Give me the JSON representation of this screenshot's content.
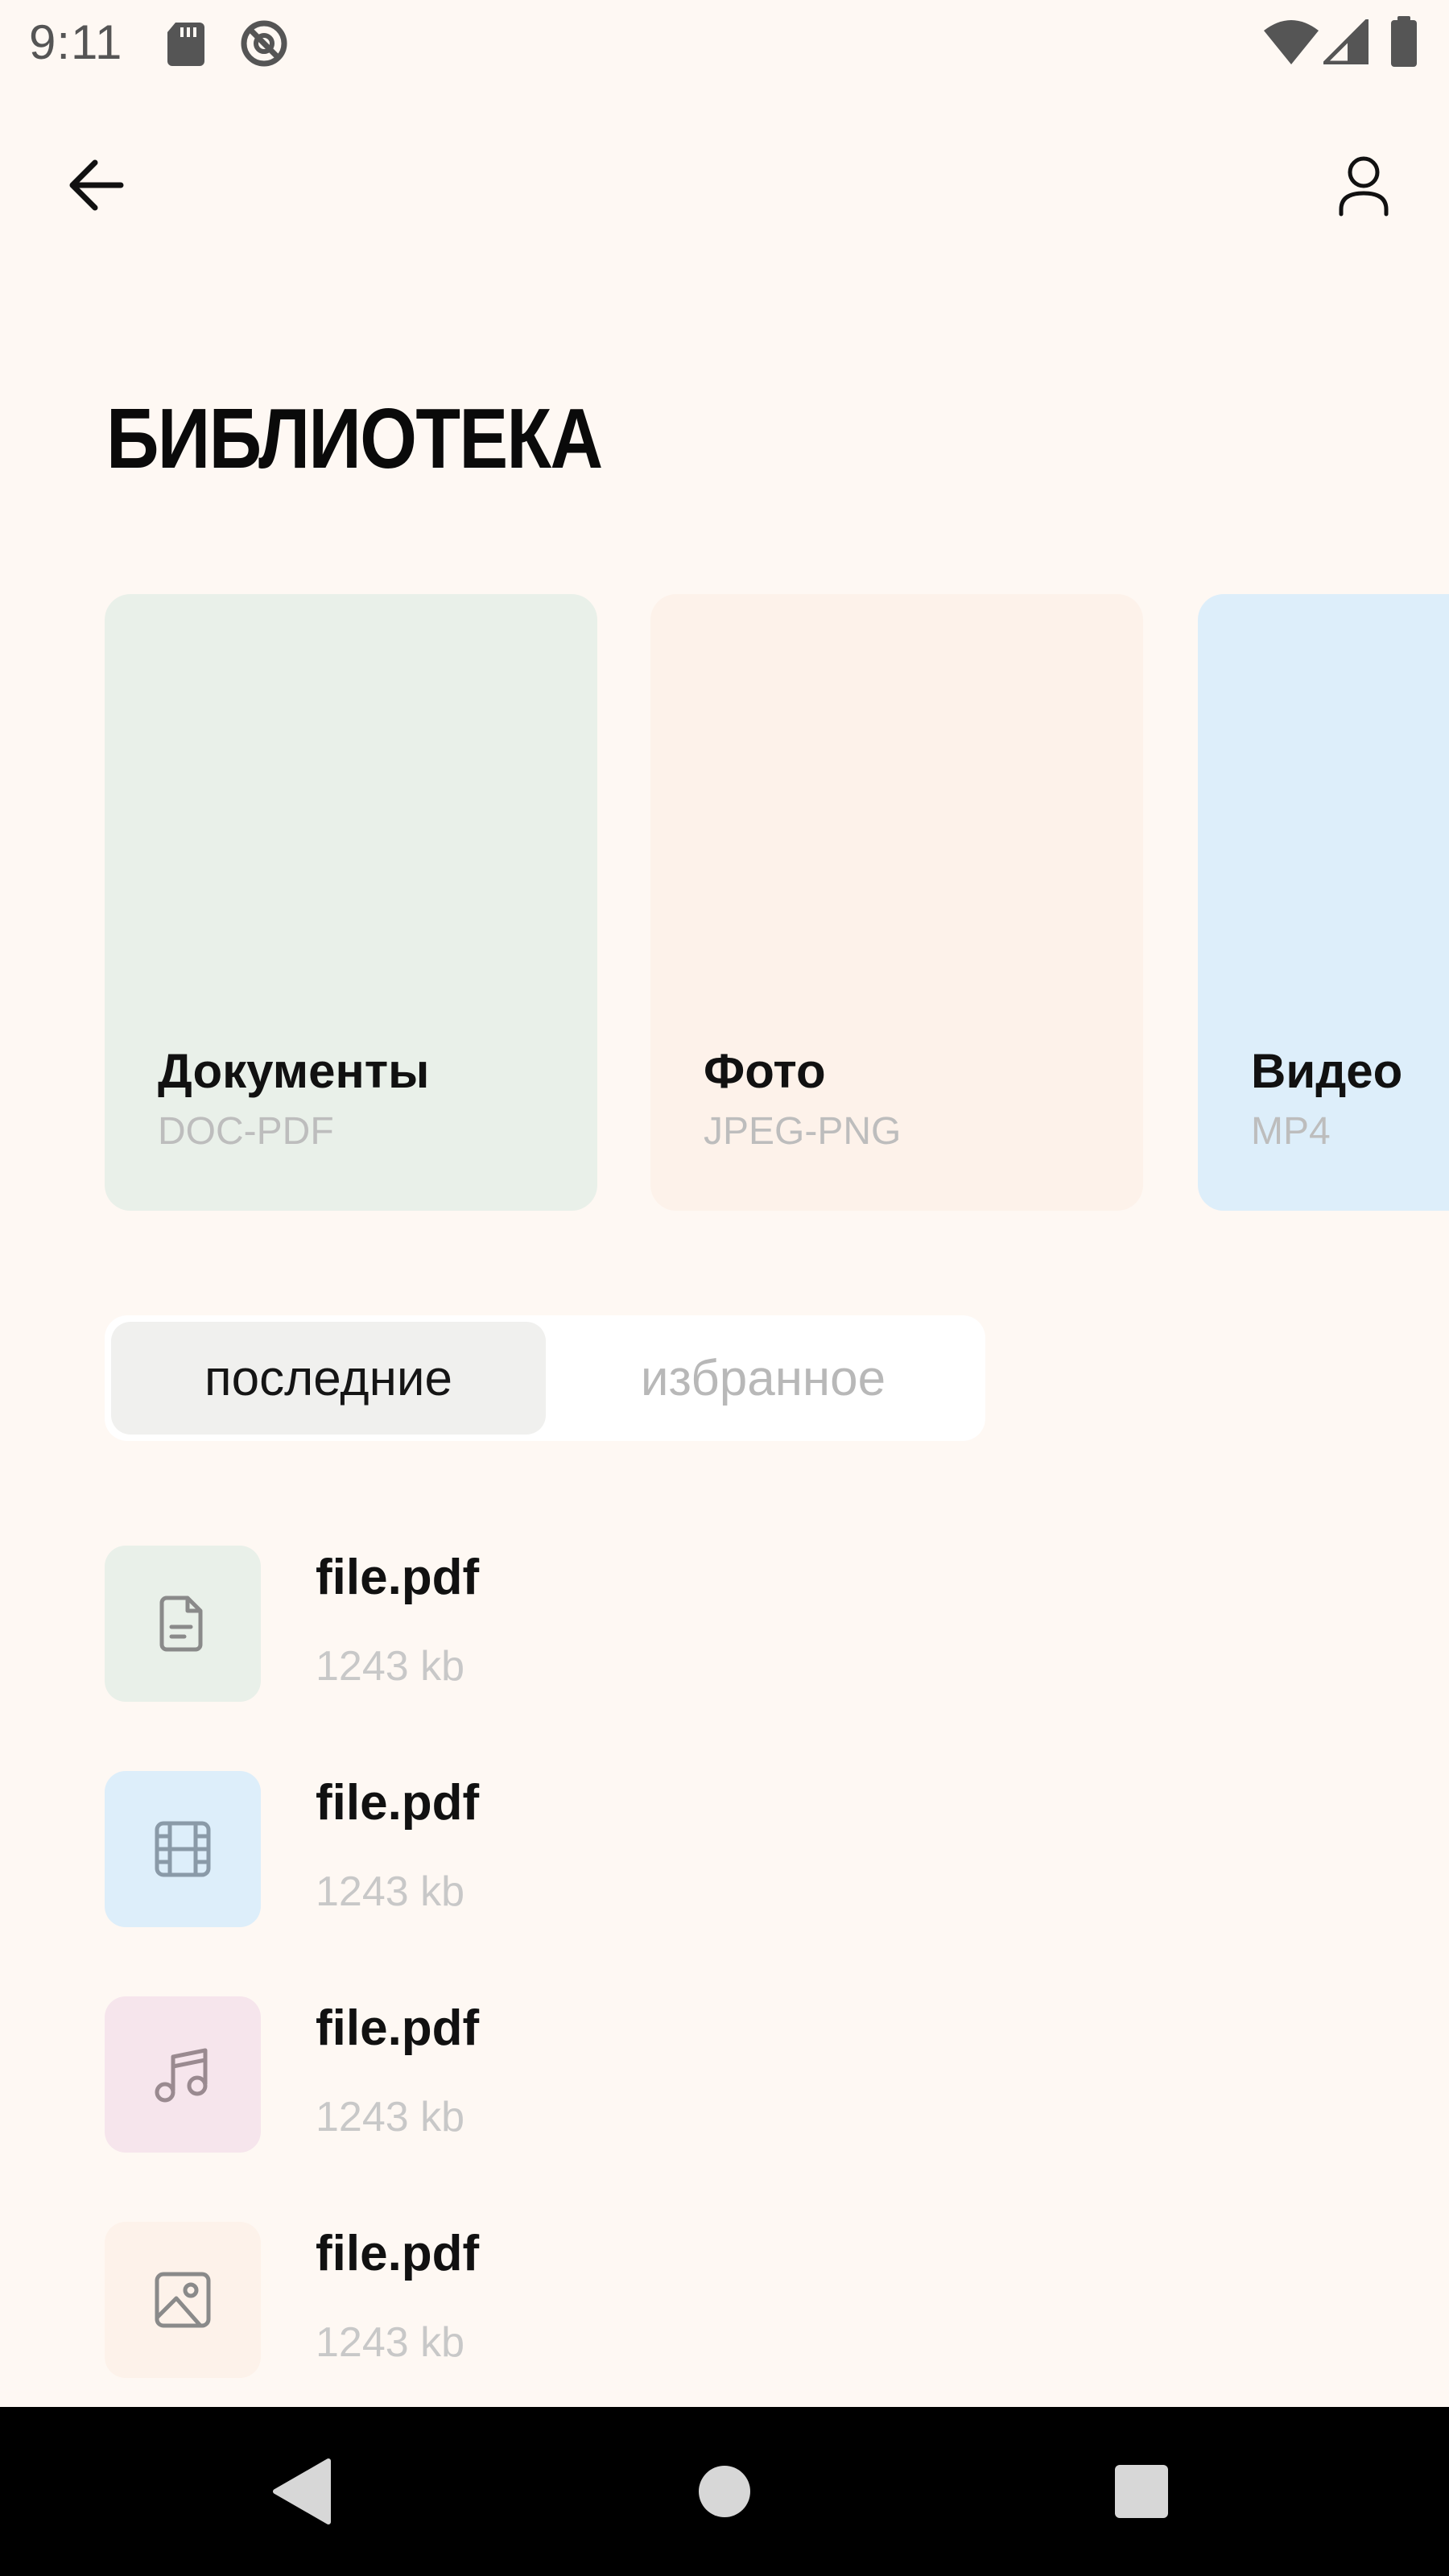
{
  "status_bar": {
    "time": "9:11"
  },
  "header": {
    "title": "БИБЛИОТЕКА"
  },
  "categories": [
    {
      "title": "Документы",
      "subtitle": "DOC-PDF",
      "color": "#e9f0e9"
    },
    {
      "title": "Фото",
      "subtitle": "JPEG-PNG",
      "color": "#fdf2ea"
    },
    {
      "title": "Видео",
      "subtitle": "MP4",
      "color": "#ddeefa"
    }
  ],
  "tabs": {
    "recent_label": "последние",
    "favorites_label": "избранное",
    "active": "recent"
  },
  "files": [
    {
      "name": "file.pdf",
      "size": "1243 kb",
      "icon": "document-icon",
      "color": "#e9f0e9"
    },
    {
      "name": "file.pdf",
      "size": "1243 kb",
      "icon": "video-icon",
      "color": "#ddeefa"
    },
    {
      "name": "file.pdf",
      "size": "1243 kb",
      "icon": "music-icon",
      "color": "#f6e5ec"
    },
    {
      "name": "file.pdf",
      "size": "1243 kb",
      "icon": "image-icon",
      "color": "#fdf2ea"
    }
  ],
  "colors": {
    "background": "#fef8f3",
    "nav_bar": "#000000"
  }
}
